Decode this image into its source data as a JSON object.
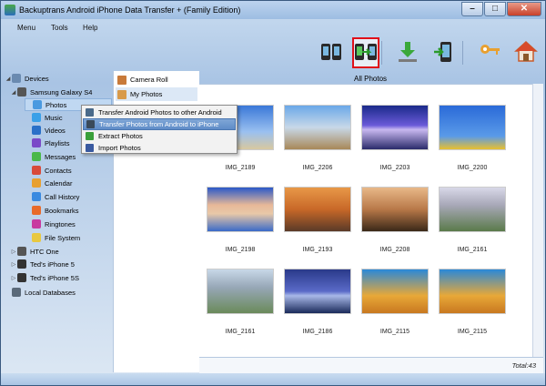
{
  "window": {
    "title": "Backuptrans Android iPhone Data Transfer + (Family Edition)",
    "minimize": "–",
    "maximize": "□",
    "close": "✕"
  },
  "menubar": [
    {
      "label": "Menu"
    },
    {
      "label": "Tools"
    },
    {
      "label": "Help"
    }
  ],
  "toolbar": {
    "buttons": [
      {
        "name": "transfer-between-phones-icon"
      },
      {
        "name": "android-to-iphone-icon",
        "selected": true
      },
      {
        "name": "download-icon"
      },
      {
        "name": "phone-export-icon"
      },
      {
        "name": "key-icon"
      },
      {
        "name": "home-icon"
      }
    ],
    "caption": "All Photos"
  },
  "tree": [
    {
      "label": "Devices",
      "icon": "devices-icon",
      "color": "#6a8ab0",
      "toggle": "◢"
    },
    {
      "label": "Samsung Galaxy S4",
      "icon": "android-phone-icon",
      "color": "#555555",
      "toggle": "◢"
    },
    {
      "label": "Photos",
      "icon": "photos-icon",
      "color": "#4a9ae0",
      "selected": true
    },
    {
      "label": "Music",
      "icon": "music-icon",
      "color": "#3aa0e8"
    },
    {
      "label": "Videos",
      "icon": "videos-icon",
      "color": "#2a70c8"
    },
    {
      "label": "Playlists",
      "icon": "playlists-icon",
      "color": "#7a4ac8"
    },
    {
      "label": "Messages",
      "icon": "messages-icon",
      "color": "#4ab84a"
    },
    {
      "label": "Contacts",
      "icon": "contacts-icon",
      "color": "#d84a3a"
    },
    {
      "label": "Calendar",
      "icon": "calendar-icon",
      "color": "#e8a030"
    },
    {
      "label": "Call History",
      "icon": "call-history-icon",
      "color": "#3a8ae0"
    },
    {
      "label": "Bookmarks",
      "icon": "bookmarks-icon",
      "color": "#e86a2a"
    },
    {
      "label": "Ringtones",
      "icon": "ringtones-icon",
      "color": "#c83aa0"
    },
    {
      "label": "File System",
      "icon": "file-system-icon",
      "color": "#e8c840"
    },
    {
      "label": "HTC One",
      "icon": "android-phone-icon",
      "color": "#555555",
      "toggle": "▷"
    },
    {
      "label": "Ted's iPhone 5",
      "icon": "iphone-icon",
      "color": "#333333",
      "toggle": "▷"
    },
    {
      "label": "Ted's iPhone 5S",
      "icon": "iphone-icon",
      "color": "#333333",
      "toggle": "▷"
    },
    {
      "label": "Local Databases",
      "icon": "database-icon",
      "color": "#5a6a7a"
    }
  ],
  "subpanel": [
    {
      "label": "Camera Roll",
      "icon": "camera-roll-icon",
      "color": "#c87a3a"
    },
    {
      "label": "My Photos",
      "icon": "my-photos-icon",
      "color": "#d89a4a",
      "selected": true
    }
  ],
  "context_menu": [
    {
      "label": "Transfer Android Photos to other Android",
      "icon": "android-transfer-icon",
      "color": "#4a6a8a"
    },
    {
      "label": "Transfer Photos from Android to iPhone",
      "icon": "android-iphone-icon",
      "color": "#3a4a5a",
      "highlighted": true
    },
    {
      "label": "Extract Photos",
      "icon": "extract-icon",
      "color": "#3aa03a"
    },
    {
      "label": "Import Photos",
      "icon": "import-icon",
      "color": "#3a5aa0"
    }
  ],
  "photos": [
    {
      "caption": "IMG_2189",
      "bg": "linear-gradient(#3a78d8,#9ac0f0 60%,#d8c8a0)"
    },
    {
      "caption": "IMG_2206",
      "bg": "linear-gradient(#6aa8e8,#c8d8e8 50%,#a88858)"
    },
    {
      "caption": "IMG_2203",
      "bg": "linear-gradient(#1a2a8a,#6a5ad8 45%,#c8b8f0 55%,#2a2a6a)"
    },
    {
      "caption": "IMG_2200",
      "bg": "linear-gradient(#2a6ad8,#5a9ae8 70%,#e8c030)"
    },
    {
      "caption": "IMG_2198",
      "bg": "linear-gradient(#2a58c8,#e8b898 40%,#e8c8a8 60%,#3a6ac8)"
    },
    {
      "caption": "IMG_2193",
      "bg": "linear-gradient(#e89848,#c86828 50%,#5a3a28)"
    },
    {
      "caption": "IMG_2208",
      "bg": "linear-gradient(#e8b888,#b87848 50%,#3a2818)"
    },
    {
      "caption": "IMG_2161",
      "bg": "linear-gradient(#d8d8e8,#a8a8b8 40%,#5a7a4a)"
    },
    {
      "caption": "IMG_2161",
      "bg": "linear-gradient(#c8d8e8,#98a8b8 40%,#6a8a5a)"
    },
    {
      "caption": "IMG_2186",
      "bg": "linear-gradient(#2a3a8a,#5a6ac8 50%,#a8b8e8 60%,#1a2a5a)"
    },
    {
      "caption": "IMG_2115",
      "bg": "linear-gradient(#2a88d8,#e8a838 60%,#c87820)"
    },
    {
      "caption": "IMG_2115",
      "bg": "linear-gradient(#2a88d8,#e8a838 60%,#c87820)"
    }
  ],
  "status": {
    "total": "Total:43"
  }
}
